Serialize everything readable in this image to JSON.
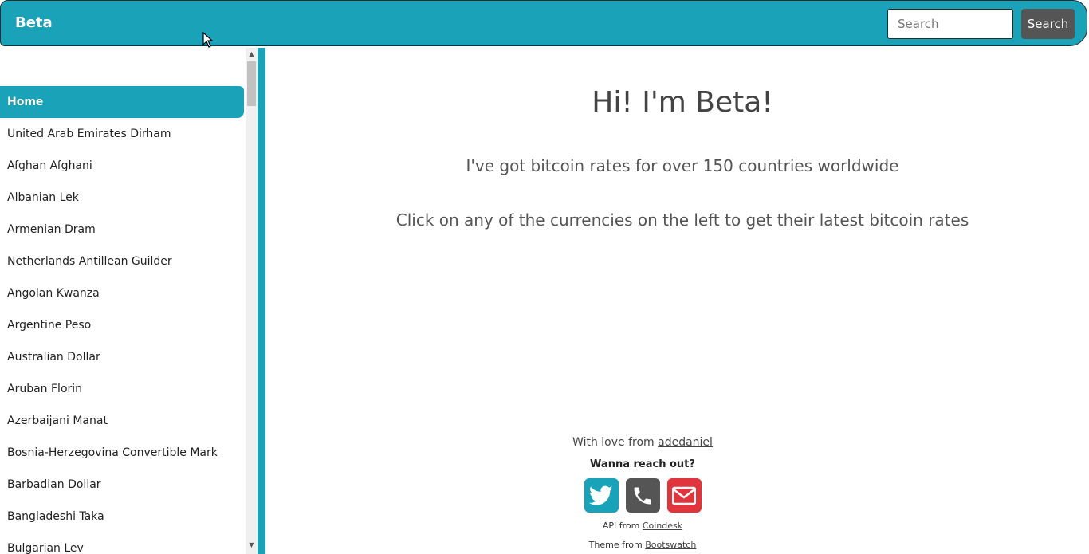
{
  "navbar": {
    "brand": "Beta",
    "search_placeholder": "Search",
    "search_button": "Search"
  },
  "sidebar": {
    "items": [
      {
        "label": "Home",
        "active": true
      },
      {
        "label": "United Arab Emirates Dirham"
      },
      {
        "label": "Afghan Afghani"
      },
      {
        "label": "Albanian Lek"
      },
      {
        "label": "Armenian Dram"
      },
      {
        "label": "Netherlands Antillean Guilder"
      },
      {
        "label": "Angolan Kwanza"
      },
      {
        "label": "Argentine Peso"
      },
      {
        "label": "Australian Dollar"
      },
      {
        "label": "Aruban Florin"
      },
      {
        "label": "Azerbaijani Manat"
      },
      {
        "label": "Bosnia-Herzegovina Convertible Mark"
      },
      {
        "label": "Barbadian Dollar"
      },
      {
        "label": "Bangladeshi Taka"
      },
      {
        "label": "Bulgarian Lev"
      }
    ]
  },
  "main": {
    "headline": "Hi! I'm Beta!",
    "tagline": "I've got bitcoin rates for over 150 countries worldwide",
    "instruction": "Click on any of the currencies on the left to get their latest bitcoin rates"
  },
  "footer": {
    "love_prefix": "With love from ",
    "love_link": "adedaniel",
    "reach_out": "Wanna reach out?",
    "social_icons": [
      "twitter-icon",
      "phone-icon",
      "email-icon"
    ],
    "api_prefix": "API from ",
    "api_link": "Coindesk",
    "theme_prefix": "Theme from ",
    "theme_link": "Bootswatch"
  },
  "colors": {
    "accent": "#1aa2b8",
    "dark": "#555555",
    "email": "#e0353c"
  }
}
